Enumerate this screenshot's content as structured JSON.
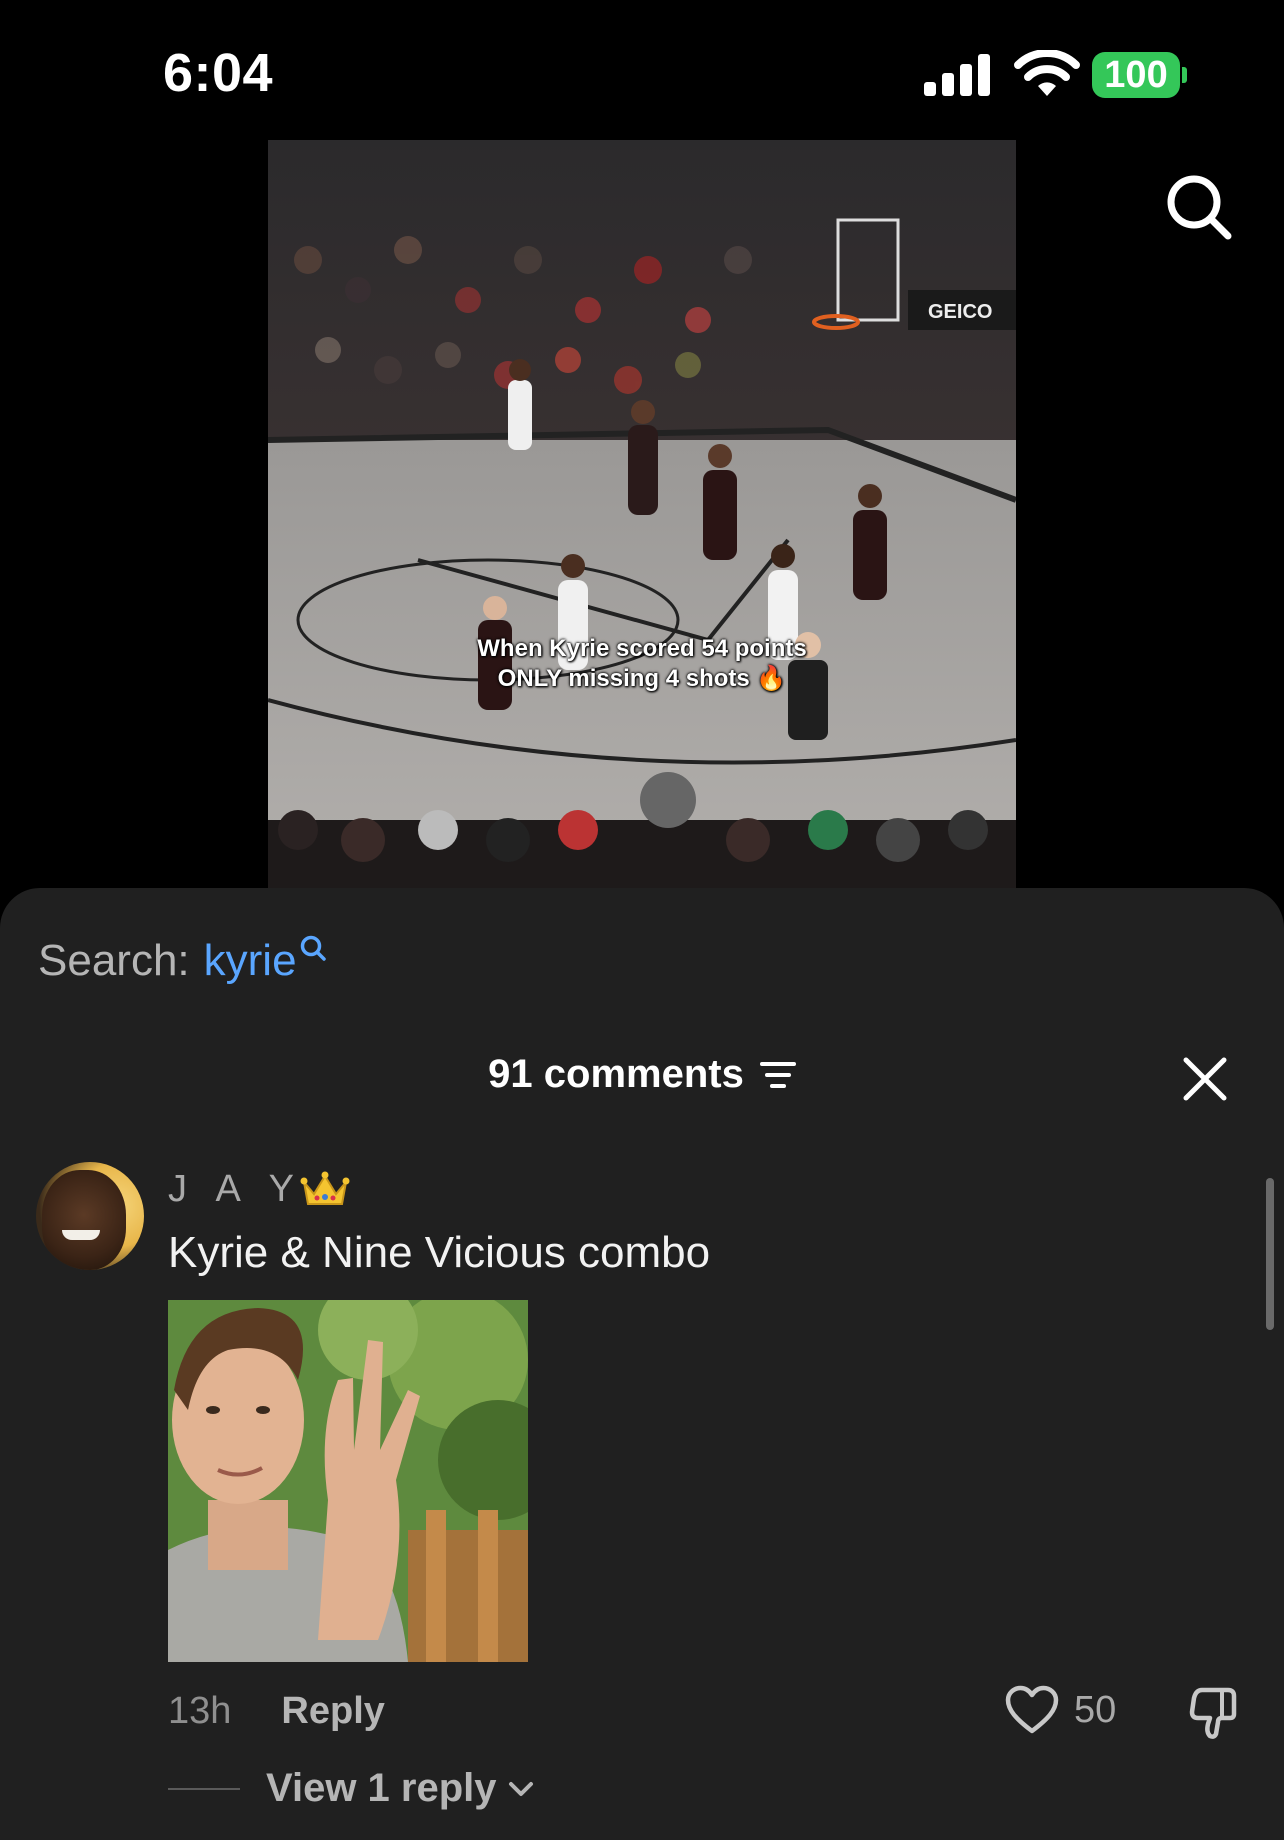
{
  "status_bar": {
    "time": "6:04",
    "battery": "100"
  },
  "video": {
    "caption": "When Kyrie scored 54 points ONLY missing 4 shots 🔥"
  },
  "search": {
    "label": "Search:",
    "term": "kyrie"
  },
  "comments": {
    "header": "91 comments",
    "items": [
      {
        "username": "J A Y",
        "text": "Kyrie & Nine Vicious combo",
        "timestamp": "13h",
        "reply_label": "Reply",
        "likes": "50",
        "view_replies": "View 1 reply"
      }
    ]
  },
  "colors": {
    "accent": "#5aa6ff",
    "sheet": "#202020",
    "battery": "#34c759"
  }
}
